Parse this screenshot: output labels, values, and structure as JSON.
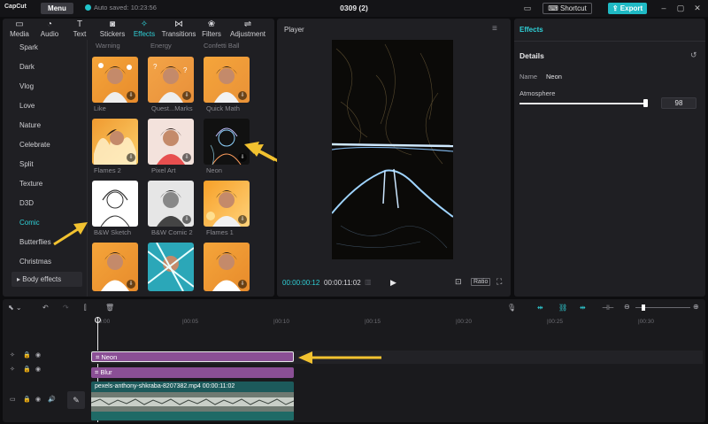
{
  "titlebar": {
    "logo": "CapCut",
    "menu_label": "Menu",
    "autosave": "Auto saved: 10:23:56",
    "doc_title": "0309 (2)",
    "shortcut_label": "Shortcut",
    "export_label": "Export"
  },
  "toolbar": {
    "tabs": [
      {
        "label": "Media",
        "icon": "media-icon"
      },
      {
        "label": "Audio",
        "icon": "audio-icon"
      },
      {
        "label": "Text",
        "icon": "text-icon"
      },
      {
        "label": "Stickers",
        "icon": "stickers-icon"
      },
      {
        "label": "Effects",
        "icon": "effects-icon"
      },
      {
        "label": "Transitions",
        "icon": "transitions-icon"
      },
      {
        "label": "Filters",
        "icon": "filters-icon"
      },
      {
        "label": "Adjustment",
        "icon": "adjustment-icon"
      }
    ],
    "active": "Effects"
  },
  "categories": {
    "items": [
      "Spark",
      "Dark",
      "Vlog",
      "Love",
      "Nature",
      "Celebrate",
      "Split",
      "Texture",
      "D3D",
      "Comic",
      "Butterflies",
      "Christmas"
    ],
    "active": "Comic",
    "body_effects": "Body effects"
  },
  "effects_grid": {
    "section_headers": [
      "Warning",
      "Energy",
      "Confetti Ball"
    ],
    "items": [
      {
        "label": "Like"
      },
      {
        "label": "Quest...Marks"
      },
      {
        "label": "Quick Math"
      },
      {
        "label": "Flames 2"
      },
      {
        "label": "Pixel Art"
      },
      {
        "label": "Neon"
      },
      {
        "label": "B&W Sketch"
      },
      {
        "label": "B&W Comic 2"
      },
      {
        "label": "Flames 1"
      },
      {
        "label": ""
      },
      {
        "label": ""
      },
      {
        "label": ""
      }
    ]
  },
  "player": {
    "title": "Player",
    "current_time": "00:00:00:12",
    "total_time": "00:00:11:02",
    "ratio_label": "Ratio"
  },
  "details": {
    "tab": "Effects",
    "section": "Details",
    "name_label": "Name",
    "name_value": "Neon",
    "atmosphere_label": "Atmosphere",
    "atmosphere_value": "98",
    "atmosphere_level": 0.98
  },
  "timeline": {
    "ruler": [
      "00:00",
      "|00:05",
      "|00:10",
      "|00:15",
      "|00:20",
      "|00:25",
      "|00:30"
    ],
    "clips": {
      "neon": "Neon",
      "blur": "Blur",
      "video": "pexels-anthony-shkraba-8207382.mp4   00:00:11:02"
    }
  },
  "colors": {
    "accent": "#2fd0d7",
    "export": "#1fb9c4",
    "effect_clip": "#8a4f95",
    "video_clip": "#1c5a5b",
    "arrow": "#f2c230"
  }
}
